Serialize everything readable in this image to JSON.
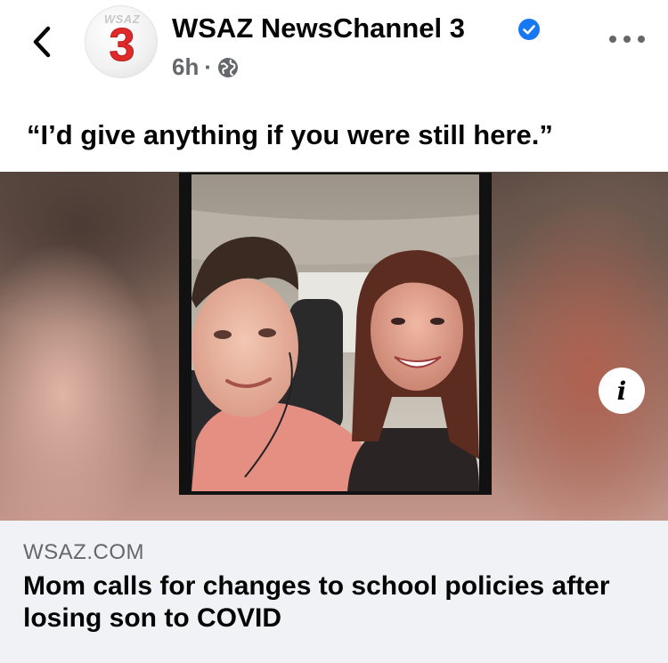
{
  "post": {
    "page_name": "WSAZ NewsChannel 3",
    "time": "6h",
    "separator": "·",
    "caption": "“I’d give anything if you were still here.”",
    "avatar": {
      "top_text": "WSAZ",
      "number": "3"
    }
  },
  "link_preview": {
    "domain": "WSAZ.COM",
    "title": "Mom calls for changes to school policies after losing son to COVID"
  },
  "icons": {
    "back": "chevron-left-icon",
    "verified": "verified-badge-icon",
    "audience": "globe-icon",
    "more": "more-dots-icon",
    "info": "info-icon"
  },
  "colors": {
    "verified_blue": "#1877f2",
    "secondary_text": "#65676b",
    "card_bg": "#f0f2f5",
    "logo_red": "#e02a2a"
  }
}
